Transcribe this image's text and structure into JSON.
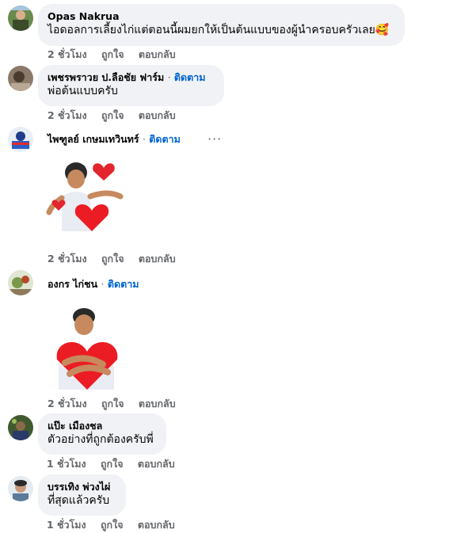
{
  "comments": [
    {
      "name": "Opas Nakrua",
      "text": "ไอดอลการเลี้ยงไก่แต่ตอนนี้ผมยกให้เป็นต้นแบบของผู้นำครอบครัวเลย",
      "time": "2 ชั่วโมง",
      "like": "ถูกใจ",
      "reply": "ตอบกลับ",
      "emoji": "🥰"
    },
    {
      "name": "เพชรพราวย ป.ลือชัย ฟาร์ม",
      "follow": "ติดตาม",
      "text": "พ่อต้นแบบครับ",
      "time": "2 ชั่วโมง",
      "like": "ถูกใจ",
      "reply": "ตอบกลับ"
    },
    {
      "name": "ไพฑูลย์ เกษมเทวินทร์",
      "follow": "ติดตาม",
      "more": "···",
      "time": "2 ชั่วโมง",
      "like": "ถูกใจ",
      "reply": "ตอบกลับ",
      "sticker": "man-throwing-hearts-sticker"
    },
    {
      "name": "องกร ไก่ชน",
      "follow": "ติดตาม",
      "time": "2 ชั่วโมง",
      "like": "ถูกใจ",
      "reply": "ตอบกลับ",
      "sticker": "man-hugging-heart-sticker"
    },
    {
      "name": "แป๊ะ เมืองชล",
      "text": "ตัวอย่างที่ถูกต้องครับพี่",
      "time": "1 ชั่วโมง",
      "like": "ถูกใจ",
      "reply": "ตอบกลับ"
    },
    {
      "name": "บรรเทิง พ่วงไผ่",
      "text": "ที่สุดแล้วครับ",
      "time": "1 ชั่วโมง",
      "like": "ถูกใจ",
      "reply": "ตอบกลับ"
    }
  ],
  "separator": "·",
  "colors": {
    "bubble": "#f0f2f5",
    "link": "#0064d1",
    "meta": "#65676b"
  }
}
